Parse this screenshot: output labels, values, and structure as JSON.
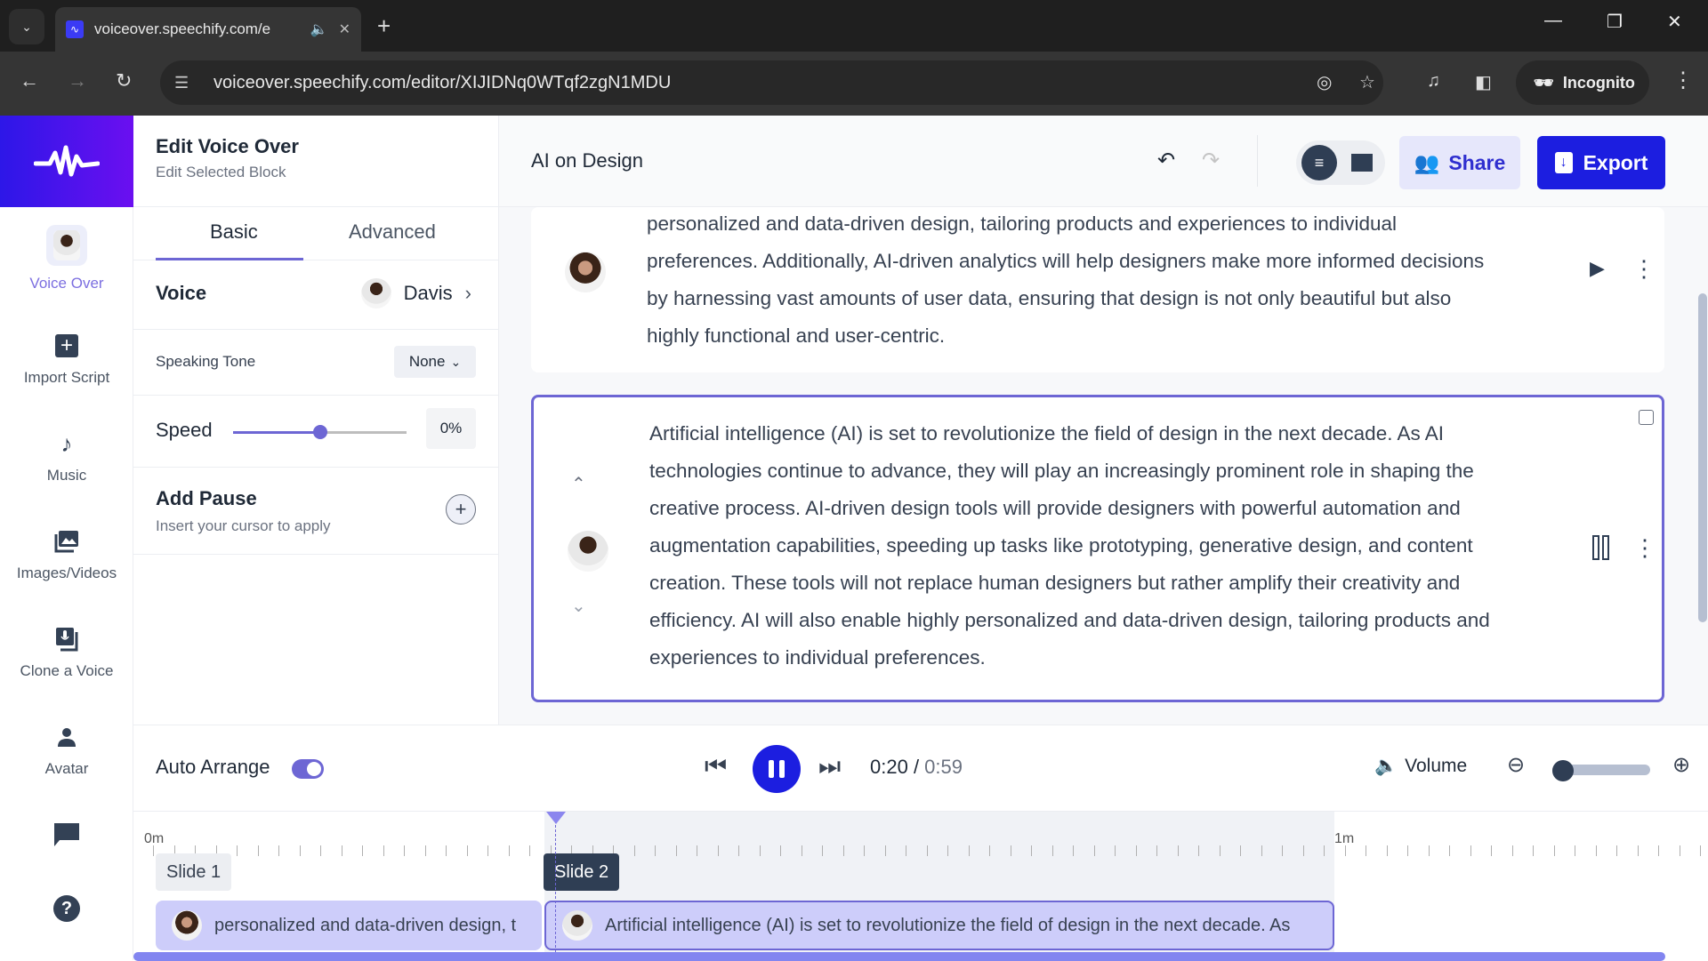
{
  "browser": {
    "tab_title": "voiceover.speechify.com/e",
    "url": "voiceover.speechify.com/editor/XIJIDNq0WTqf2zgN1MDU",
    "profile_label": "Incognito"
  },
  "rail": {
    "items": [
      {
        "label": "Voice Over",
        "icon": "voice-avatar",
        "active": true
      },
      {
        "label": "Import Script",
        "icon": "plus-square-icon"
      },
      {
        "label": "Music",
        "icon": "music-note-icon"
      },
      {
        "label": "Images/Videos",
        "icon": "images-icon"
      },
      {
        "label": "Clone a Voice",
        "icon": "mic-stack-icon"
      },
      {
        "label": "Avatar",
        "icon": "person-icon"
      },
      {
        "label": "",
        "icon": "chat-icon"
      },
      {
        "label": "",
        "icon": "help-icon"
      }
    ]
  },
  "left_panel": {
    "title": "Edit Voice Over",
    "subtitle": "Edit Selected Block",
    "tabs": [
      "Basic",
      "Advanced"
    ],
    "active_tab": "Basic",
    "voice_label": "Voice",
    "voice_name": "Davis",
    "tone_label": "Speaking Tone",
    "tone_value": "None",
    "speed_label": "Speed",
    "speed_value": "0%",
    "speed_slider_fraction": 0.5,
    "pause_title": "Add Pause",
    "pause_hint": "Insert your cursor to apply"
  },
  "main": {
    "project_title": "AI on Design",
    "share_label": "Share",
    "export_label": "Export",
    "blocks": [
      {
        "lines": [
          "personalized and data-driven design, tailoring products and experiences to individual",
          "preferences. Additionally, AI-driven analytics will help designers make more informed decisions",
          "by harnessing vast amounts of user data, ensuring that design is not only beautiful but also",
          "highly functional and user-centric."
        ],
        "state": "paused"
      },
      {
        "lines": [
          "Artificial intelligence (AI) is set to revolutionize the field of design in the next decade. As AI",
          "technologies continue to advance, they will play an increasingly prominent role in shaping the",
          "creative process. AI-driven design tools will provide designers with powerful automation and",
          "augmentation capabilities, speeding up tasks like prototyping, generative design, and content",
          "creation. These tools will not replace human designers but rather amplify their creativity and",
          "efficiency. AI will also enable highly personalized and data-driven design, tailoring products and",
          "experiences to individual preferences."
        ],
        "state": "playing",
        "selected": true
      }
    ]
  },
  "player": {
    "auto_arrange_label": "Auto Arrange",
    "auto_arrange_on": true,
    "current_time": "0:20",
    "separator": " / ",
    "total_time": "0:59",
    "volume_label": "Volume",
    "zoom_fraction": 0.0
  },
  "timeline": {
    "ruler_labels": [
      "0m",
      "1m"
    ],
    "slides": [
      "Slide 1",
      "Slide 2"
    ],
    "clips": [
      "personalized and data-driven design, t",
      "Artificial intelligence (AI) is set to revolutionize the field of design in the next decade. As"
    ]
  }
}
